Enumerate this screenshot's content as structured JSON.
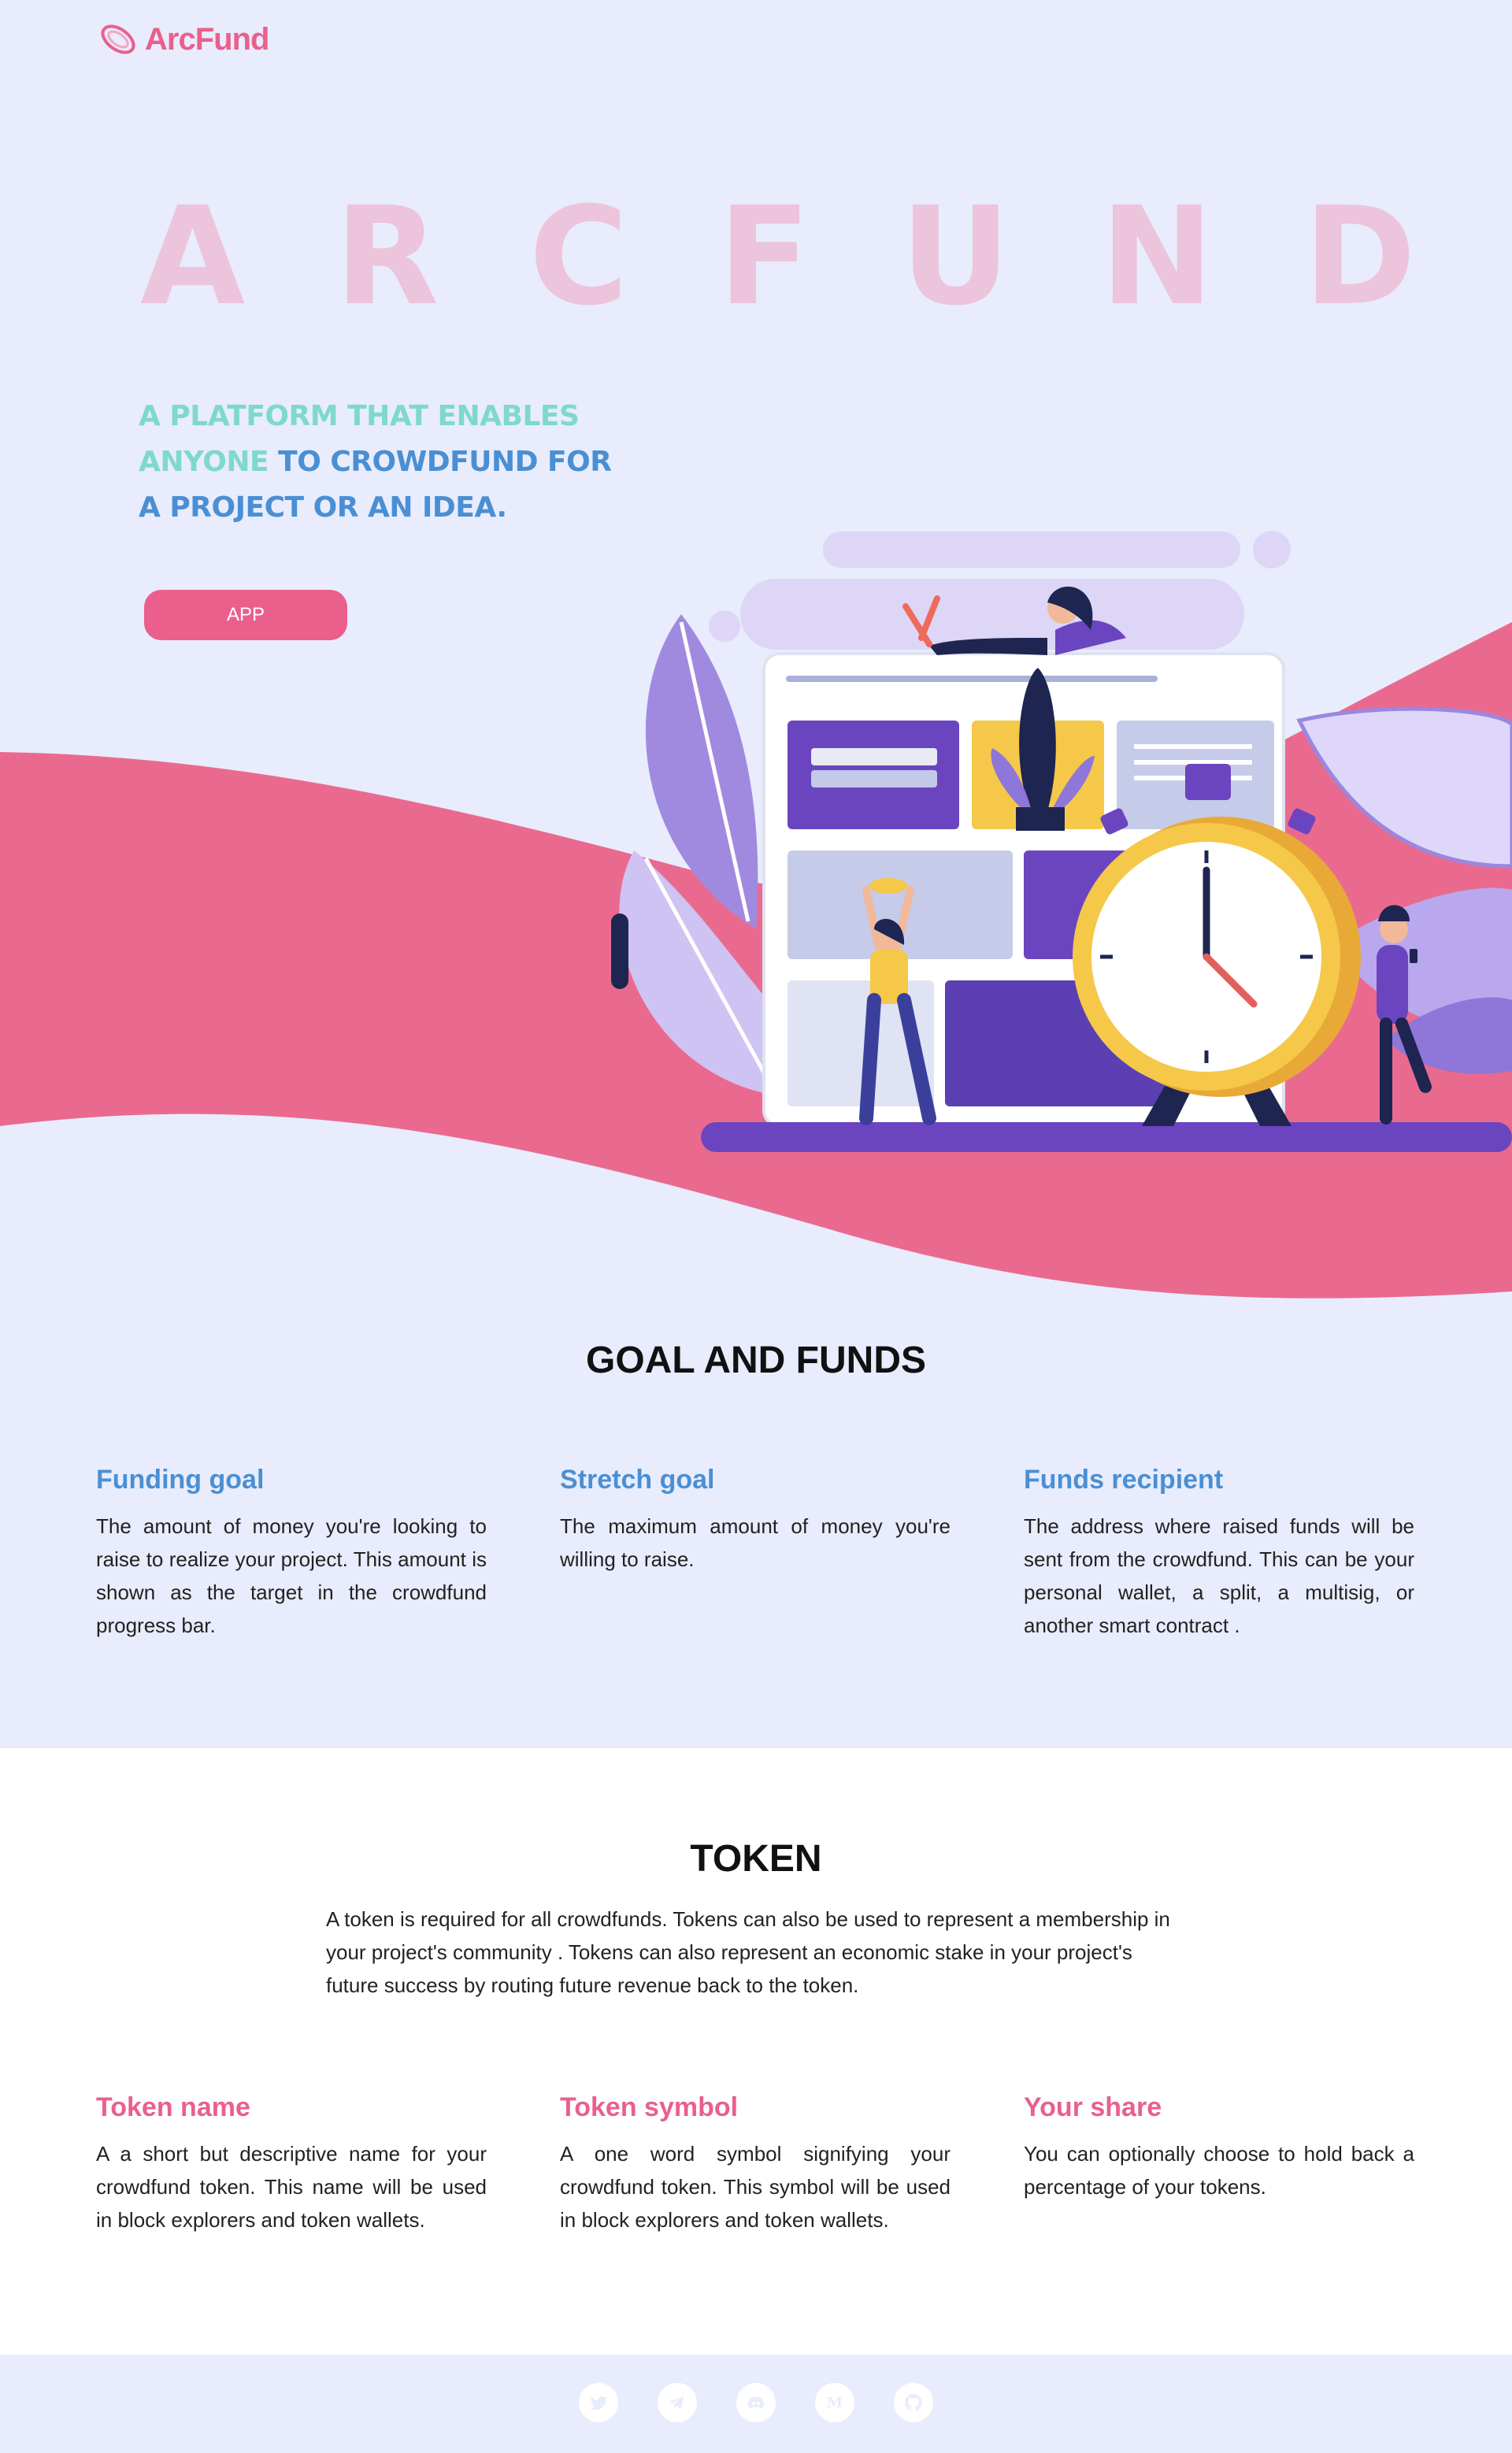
{
  "brand": {
    "name": "ArcFund",
    "color": "#ea5f8c"
  },
  "hero": {
    "big_letters": [
      "A",
      "R",
      "C",
      "F",
      "U",
      "N",
      "D"
    ],
    "tagline_mint_1": "A PLATFORM THAT ENABLES",
    "tagline_mint_2": "ANYONE",
    "tagline_blue_1": " TO CROWDFUND FOR",
    "tagline_blue_2": "A PROJECT OR AN IDEA.",
    "app_button": "APP"
  },
  "goal_section": {
    "title": "GOAL AND FUNDS",
    "columns": [
      {
        "heading": "Funding goal",
        "text": "The amount of money you're looking to raise to realize your project. This amount is shown as the target in the crowdfund progress bar."
      },
      {
        "heading": "Stretch goal",
        "text": "The maximum amount of money you're willing to raise."
      },
      {
        "heading": "Funds recipient",
        "text": "The address where raised funds will be sent from the crowdfund. This can be your personal wallet, a split, a multisig, or another smart contract ."
      }
    ]
  },
  "token_section": {
    "title": "TOKEN",
    "intro": "A token is required for all crowdfunds.  Tokens can also be used to represent a membership in your project's community . Tokens can also represent an economic stake in your project's future success by routing future revenue back to the token.",
    "columns": [
      {
        "heading": "Token name",
        "text": "A a short but descriptive name for your crowdfund token. This name will be used in block explorers and token wallets."
      },
      {
        "heading": "Token symbol",
        "text": "A one word symbol signifying your crowdfund token. This symbol will be used in block explorers and token wallets."
      },
      {
        "heading": "Your share",
        "text": "You can optionally choose to hold back a percentage of your tokens."
      }
    ]
  },
  "footer": {
    "social": [
      "twitter-icon",
      "telegram-icon",
      "discord-icon",
      "medium-icon",
      "github-icon"
    ]
  },
  "colors": {
    "background": "#e8ecfc",
    "pink": "#ea5f8c",
    "blue": "#4a8fd4",
    "mint": "#7fd8cf",
    "purple": "#5b3fb3",
    "yellow": "#f5c84a"
  }
}
